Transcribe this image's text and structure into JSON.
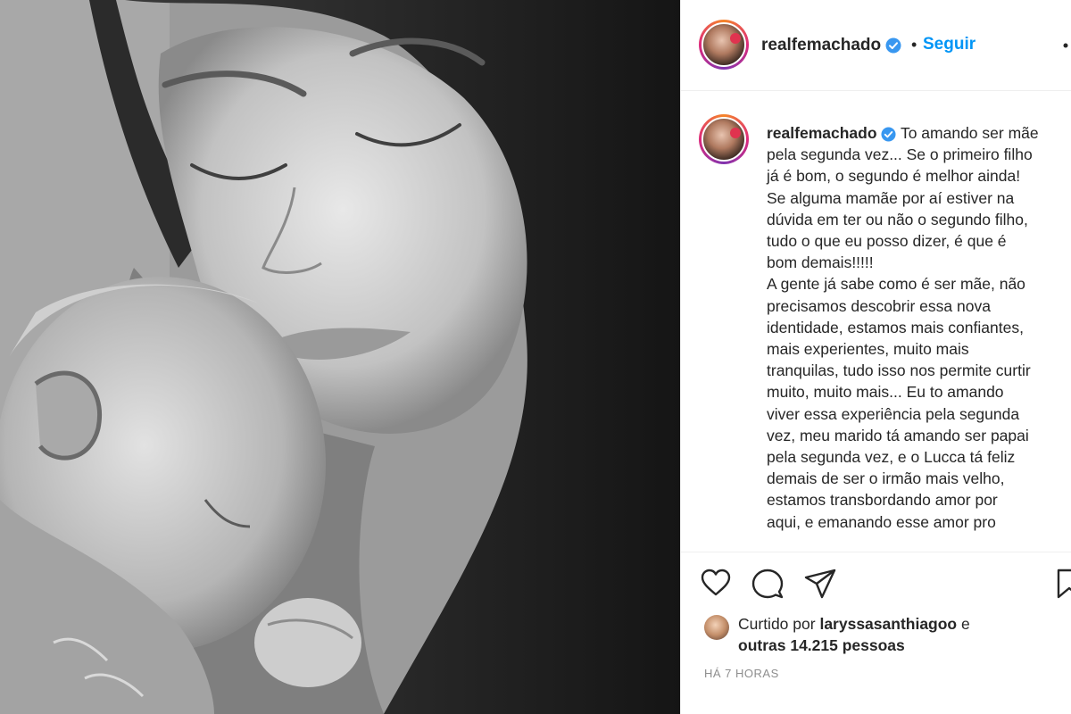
{
  "post": {
    "username": "realfemachado",
    "follow_label": "Seguir",
    "separator": "•",
    "caption_lines": [
      "To amando ser mãe",
      "pela segunda vez... Se o primeiro filho",
      "já é bom, o segundo é melhor ainda!",
      "Se alguma mamãe por aí estiver na",
      "dúvida em ter ou não o segundo filho,",
      "tudo o que eu posso dizer, é que é",
      "bom demais!!!!!",
      "A gente já sabe como é ser mãe, não",
      "precisamos descobrir essa nova",
      "identidade, estamos mais confiantes,",
      "mais experientes, muito mais",
      "tranquilas, tudo isso nos permite curtir",
      "muito, muito mais... Eu to amando",
      "viver essa experiência pela segunda",
      "vez, meu marido tá amando ser papai",
      "pela segunda vez, e o Lucca tá feliz",
      "demais de ser o irmão mais velho,",
      "estamos transbordando amor por",
      "aqui, e emanando esse amor pro"
    ],
    "liked_by": {
      "prefix": "Curtido por",
      "user": "laryssasanthiagoo",
      "conj": "e",
      "others": "outras 14.215 pessoas"
    },
    "timestamp": "HÁ 7 HORAS"
  },
  "colors": {
    "link_blue": "#0095f6",
    "verified_blue": "#3897f0",
    "text": "#262626",
    "muted": "#8e8e8e"
  },
  "icons": [
    "verified-badge-icon",
    "more-options-icon",
    "heart-icon",
    "comment-icon",
    "share-icon",
    "bookmark-icon"
  ]
}
